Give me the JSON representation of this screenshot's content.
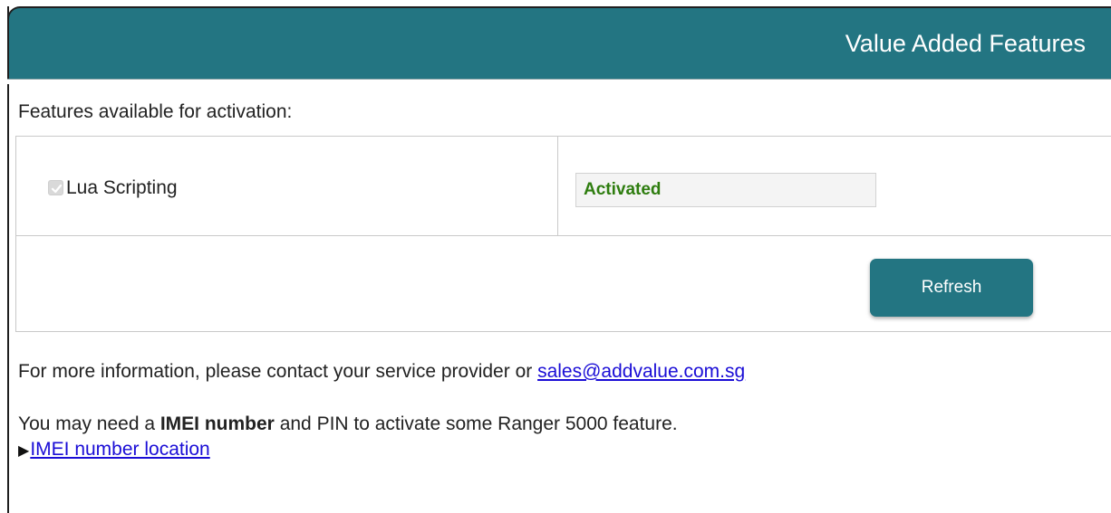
{
  "header": {
    "title": "Value Added Features"
  },
  "features_section": {
    "label": "Features available for activation:",
    "features": [
      {
        "name": "Lua Scripting",
        "checked": true,
        "disabled": true,
        "status": "Activated"
      }
    ],
    "refresh_label": "Refresh"
  },
  "info": {
    "contact_text": "For more information, please contact your service provider or ",
    "contact_email": "sales@addvalue.com.sg",
    "imei_prefix": "You may need a ",
    "imei_bold": "IMEI number",
    "imei_suffix": " and PIN to activate some Ranger 5000 feature.",
    "imei_link_icon": "▶",
    "imei_link_label": "IMEI number location"
  },
  "colors": {
    "header_bg": "#237582",
    "button_bg": "#237582",
    "status_text": "#2e7d0f",
    "link": "#1a0dd6"
  }
}
